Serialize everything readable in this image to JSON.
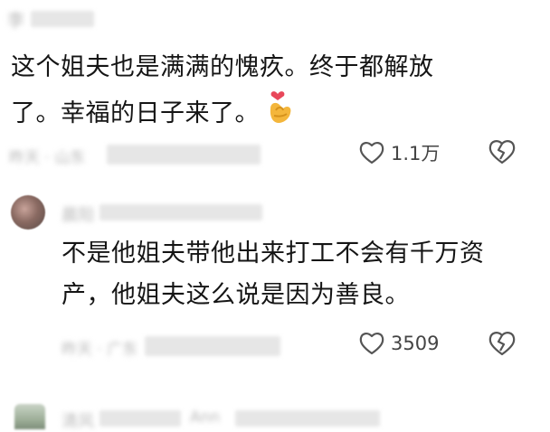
{
  "comments": [
    {
      "author": "李",
      "text_line1": "这个姐夫也是满满的愧疚。终于都解放",
      "text_line2": "了。幸福的日子来了。",
      "meta": "昨天 · 山东",
      "likes": "1.1万"
    },
    {
      "author": "晨阳",
      "text_line1": "不是他姐夫带他出来打工不会有千万资",
      "text_line2": "产，他姐夫这么说是因为善良。",
      "meta": "昨天 · 广东",
      "likes": "3509"
    },
    {
      "author": "清风",
      "meta": "Ann",
      "likes": ""
    }
  ],
  "icons": {
    "like": "heart-outline-icon",
    "dislike": "broken-heart-icon",
    "emoji": "heart-hands-emoji"
  },
  "colors": {
    "text": "#151515",
    "meta": "#444444",
    "emoji": "#f4b63b",
    "heart": "#e8475a"
  }
}
